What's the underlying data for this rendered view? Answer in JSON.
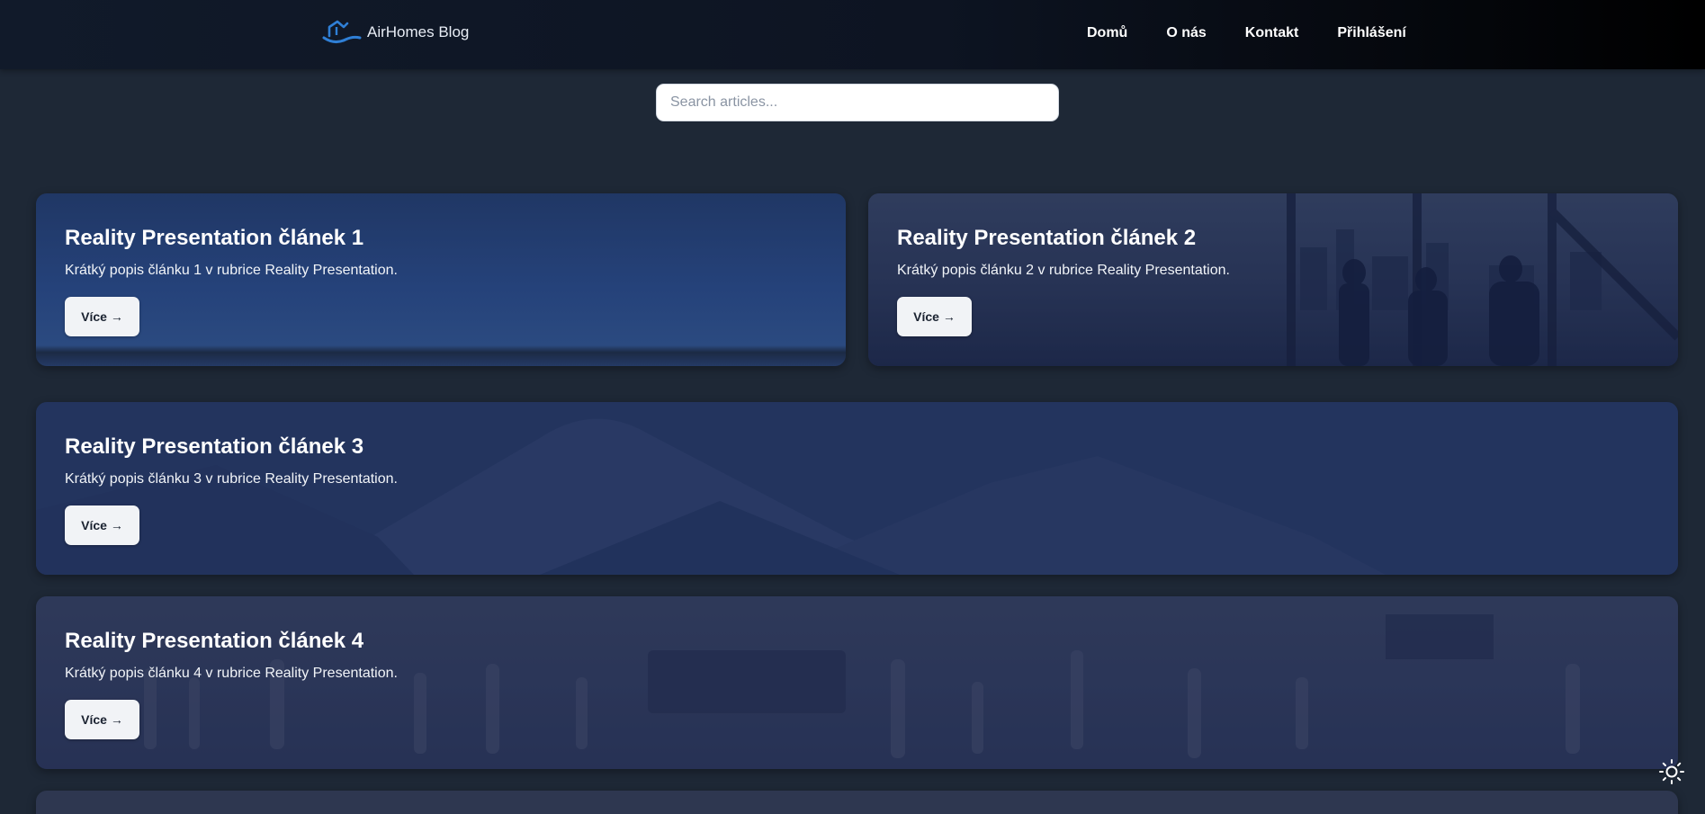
{
  "header": {
    "brand_name": "AirHomes Blog",
    "nav": [
      "Domů",
      "O nás",
      "Kontakt",
      "Přihlášení"
    ]
  },
  "search": {
    "placeholder": "Search articles..."
  },
  "cards": [
    {
      "title": "Reality Presentation článek 1",
      "description": "Krátký popis článku 1 v rubrice Reality Presentation.",
      "button": "Více →"
    },
    {
      "title": "Reality Presentation článek 2",
      "description": "Krátký popis článku 2 v rubrice Reality Presentation.",
      "button": "Více →"
    },
    {
      "title": "Reality Presentation článek 3",
      "description": "Krátký popis článku 3 v rubrice Reality Presentation.",
      "button": "Více →"
    },
    {
      "title": "Reality Presentation článek 4",
      "description": "Krátký popis článku 4 v rubrice Reality Presentation.",
      "button": "Více →"
    }
  ],
  "colors": {
    "page_bg": "#1e2836",
    "card_overlay": "#1f3260",
    "accent_logo": "#2f7fd6",
    "button_bg": "#f1f3f6"
  },
  "icons": {
    "logo": "house-wave-logo-icon",
    "theme_toggle": "sun-icon"
  }
}
